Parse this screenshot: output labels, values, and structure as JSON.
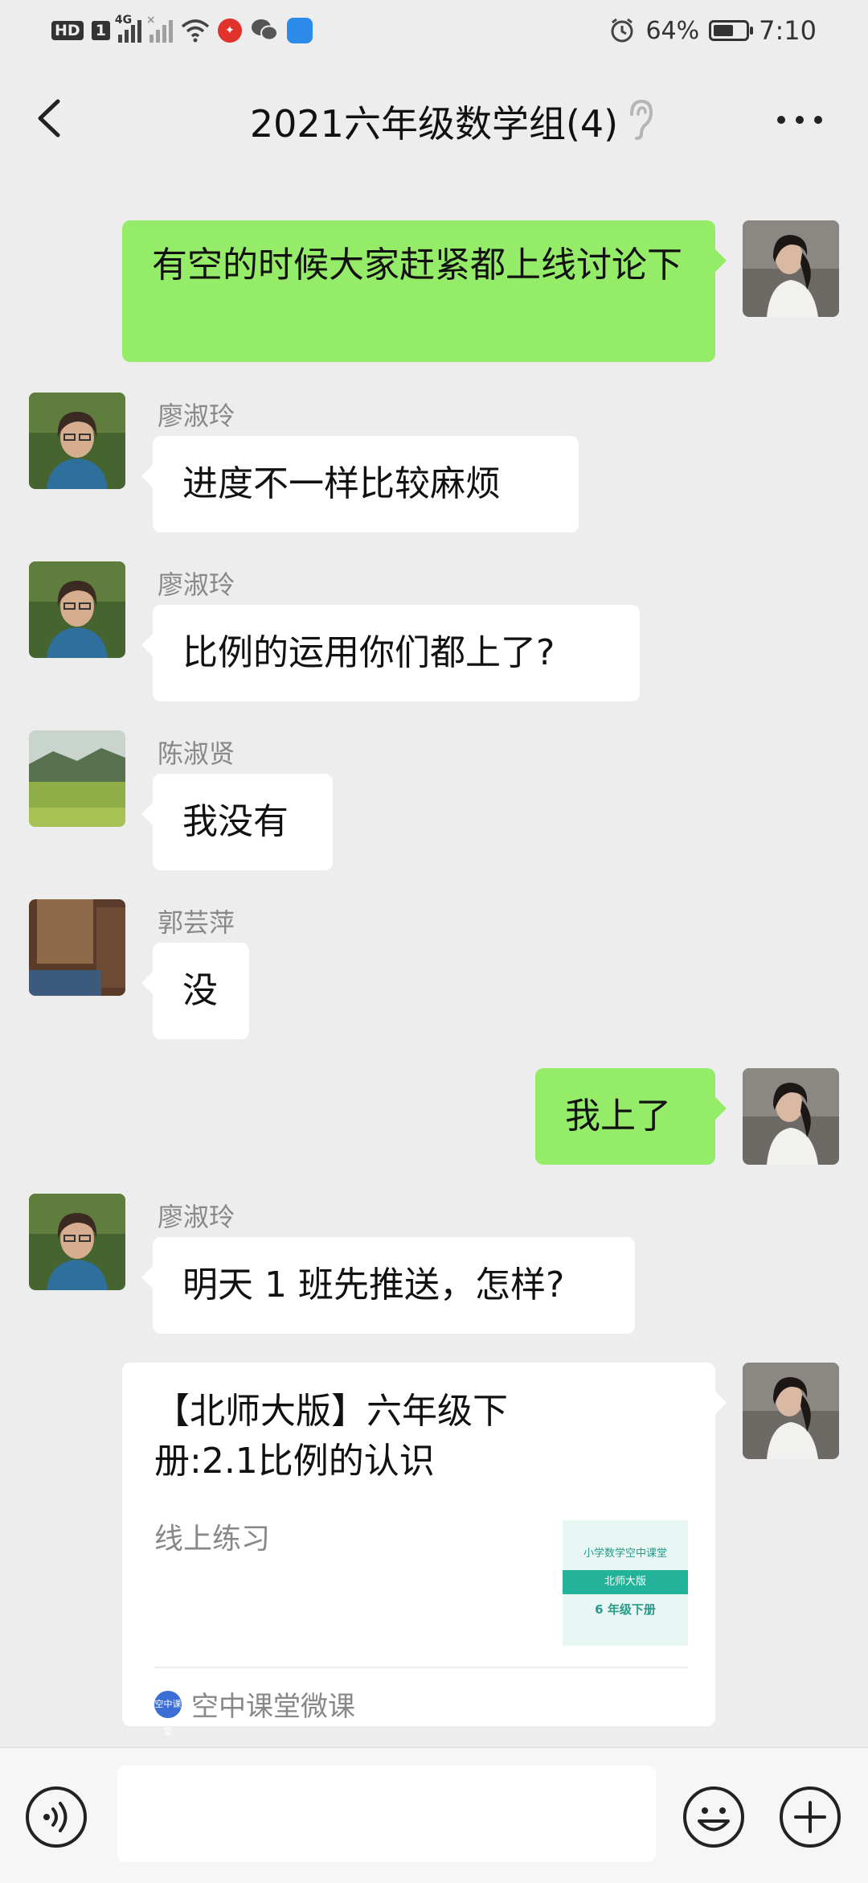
{
  "status_bar": {
    "hd_label": "HD",
    "sim_label": "1",
    "network_label": "4G",
    "signal2_label": "×",
    "battery_percent": "64%",
    "battery_level": 0.64,
    "time": "7:10"
  },
  "header": {
    "title": "2021六年级数学组(4)"
  },
  "messages": [
    {
      "sender": "",
      "direction": "out",
      "text": "有空的时候大家赶紧都上线讨论下"
    },
    {
      "sender": "廖淑玲",
      "direction": "in",
      "text": "进度不一样比较麻烦"
    },
    {
      "sender": "廖淑玲",
      "direction": "in",
      "text": "比例的运用你们都上了?"
    },
    {
      "sender": "陈淑贤",
      "direction": "in",
      "text": "我没有"
    },
    {
      "sender": "郭芸萍",
      "direction": "in",
      "text": "没"
    },
    {
      "sender": "",
      "direction": "out",
      "text": "我上了"
    },
    {
      "sender": "廖淑玲",
      "direction": "in",
      "text": "明天 1 班先推送，怎样?"
    }
  ],
  "link_card": {
    "title": "【北师大版】六年级下册:2.1比例的认识",
    "description": "线上练习",
    "thumb_line1": "小学数学空中课堂",
    "thumb_line2": "北师大版",
    "thumb_line3": "6 年级下册",
    "source": "空中课堂微课",
    "source_icon_text": "空中课堂"
  },
  "colors": {
    "background": "#ededed",
    "outgoing_bubble": "#95ec69",
    "incoming_bubble": "#ffffff",
    "sender_name": "#888888"
  },
  "icons": {
    "back": "chevron-left-icon",
    "ear": "ear-icon",
    "more": "more-icon",
    "voice": "voice-icon",
    "emoji": "emoji-icon",
    "plus": "plus-icon"
  }
}
